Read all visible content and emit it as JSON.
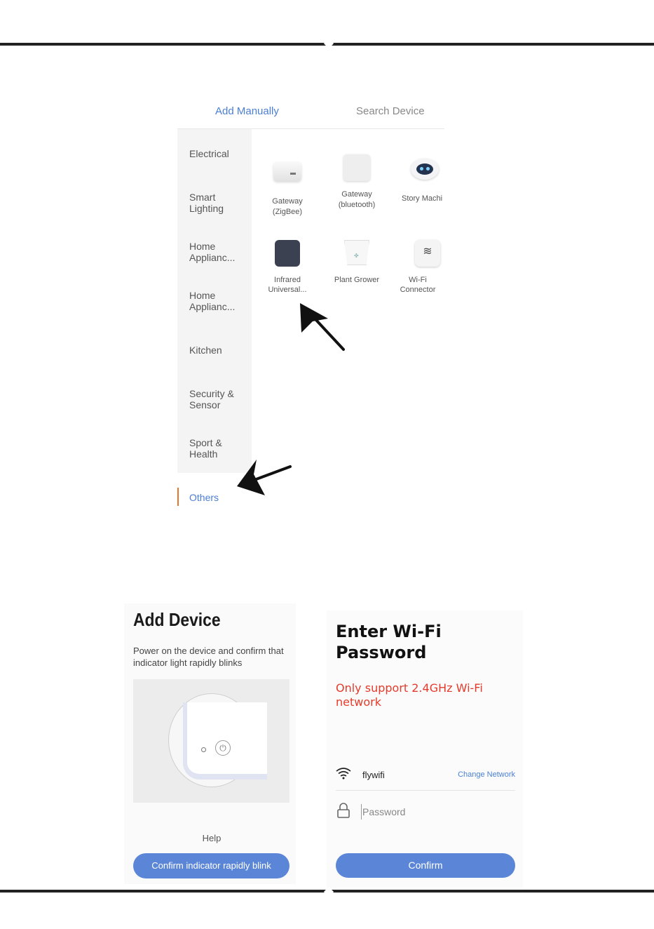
{
  "add_screen": {
    "tabs": [
      {
        "label": "Add Manually",
        "active": true
      },
      {
        "label": "Search Device",
        "active": false
      }
    ],
    "categories": [
      {
        "label": "Electrical"
      },
      {
        "label": "Smart Lighting"
      },
      {
        "label": "Home Applianc..."
      },
      {
        "label": "Home Applianc..."
      },
      {
        "label": "Kitchen"
      },
      {
        "label": "Security & Sensor"
      },
      {
        "label": "Sport & Health"
      },
      {
        "label": "Others",
        "selected": true
      }
    ],
    "devices": [
      {
        "line1": "Gateway",
        "line2": "(ZigBee)",
        "icon": "zigbee-gateway-icon"
      },
      {
        "line1": "Gateway",
        "line2": "(bluetooth)",
        "icon": "bluetooth-gateway-icon"
      },
      {
        "line1": "Story Machi",
        "line2": "",
        "icon": "story-machine-robot-icon"
      },
      {
        "line1": "Infrared",
        "line2": "Universal...",
        "icon": "infrared-remote-icon"
      },
      {
        "line1": "Plant Grower",
        "line2": "",
        "icon": "plant-pot-icon"
      },
      {
        "line1": "Wi-Fi",
        "line2": "Connector",
        "icon": "wifi-connector-icon"
      }
    ],
    "accent_color": "#4a7fd4",
    "selected_marker_color": "#e8742b"
  },
  "add_device": {
    "title": "Add Device",
    "description": "Power on the device and confirm that indicator light rapidly blinks",
    "help": "Help",
    "button": "Confirm indicator rapidly blink"
  },
  "wifi": {
    "title": "Enter Wi-Fi Password",
    "warning": "Only support 2.4GHz Wi-Fi network",
    "network_name": "flywifi",
    "change_network": "Change Network",
    "password_placeholder": "Password",
    "password_value": "",
    "button": "Confirm",
    "warning_color": "#e53b2c",
    "button_color": "#5b86d8"
  }
}
